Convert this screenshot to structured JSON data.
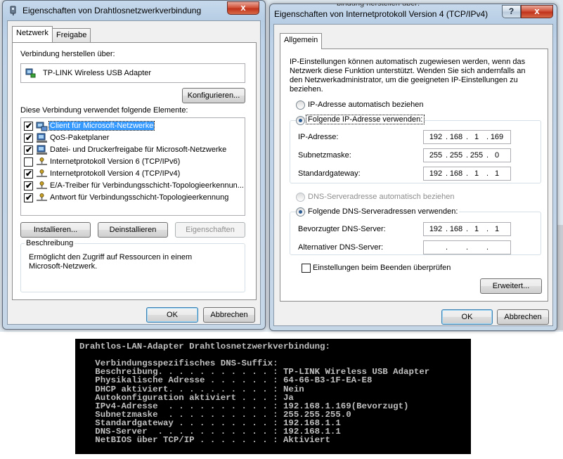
{
  "window1": {
    "title": "Eigenschaften von Drahtlosnetzwerkverbindung",
    "close_label": "x",
    "tabs": [
      {
        "label": "Netzwerk"
      },
      {
        "label": "Freigabe"
      }
    ],
    "connect_via_label": "Verbindung herstellen über:",
    "adapter_name": "TP-LINK Wireless USB Adapter",
    "configure_label": "Konfigurieren...",
    "elements_label": "Diese Verbindung verwendet folgende Elemente:",
    "items": [
      {
        "label": "Client für Microsoft-Netzwerke",
        "checked": true,
        "selected": true,
        "icon": "network-client-icon"
      },
      {
        "label": "QoS-Paketplaner",
        "checked": true,
        "selected": false,
        "icon": "network-service-icon"
      },
      {
        "label": "Datei- und Druckerfreigabe für Microsoft-Netzwerke",
        "checked": true,
        "selected": false,
        "icon": "network-service-icon"
      },
      {
        "label": "Internetprotokoll Version 6 (TCP/IPv6)",
        "checked": false,
        "selected": false,
        "icon": "protocol-icon"
      },
      {
        "label": "Internetprotokoll Version 4 (TCP/IPv4)",
        "checked": true,
        "selected": false,
        "icon": "protocol-icon"
      },
      {
        "label": "E/A-Treiber für Verbindungsschicht-Topologieerkennun...",
        "checked": true,
        "selected": false,
        "icon": "protocol-icon"
      },
      {
        "label": "Antwort für Verbindungsschicht-Topologieerkennung",
        "checked": true,
        "selected": false,
        "icon": "protocol-icon"
      }
    ],
    "install_label": "Installieren...",
    "uninstall_label": "Deinstallieren",
    "properties_label": "Eigenschaften",
    "description_title": "Beschreibung",
    "description_line1": "Ermöglicht den Zugriff auf Ressourcen in einem",
    "description_line2": "Microsoft-Netzwerk.",
    "ok_label": "OK",
    "cancel_label": "Abbrechen"
  },
  "window2": {
    "title": "Eigenschaften von Internetprotokoll Version 4 (TCP/IPv4)",
    "help_label": "?",
    "close_label": "x",
    "tab_label": "Allgemein",
    "info_line1": "IP-Einstellungen können automatisch zugewiesen werden, wenn das",
    "info_line2": "Netzwerk diese Funktion unterstützt. Wenden Sie sich andernfalls an",
    "info_line3": "den Netzwerkadministrator, um die geeigneten IP-Einstellungen zu",
    "info_line4": "beziehen.",
    "radio_ip_auto": "IP-Adresse automatisch beziehen",
    "radio_ip_manual": "Folgende IP-Adresse verwenden:",
    "ip_label": "IP-Adresse:",
    "ip": [
      "192",
      "168",
      "1",
      "169"
    ],
    "subnet_label": "Subnetzmaske:",
    "subnet": [
      "255",
      "255",
      "255",
      "0"
    ],
    "gateway_label": "Standardgateway:",
    "gateway": [
      "192",
      "168",
      "1",
      "1"
    ],
    "radio_dns_auto": "DNS-Serveradresse automatisch beziehen",
    "radio_dns_manual": "Folgende DNS-Serveradressen verwenden:",
    "dns_pref_label": "Bevorzugter DNS-Server:",
    "dns_pref": [
      "192",
      "168",
      "1",
      "1"
    ],
    "dns_alt_label": "Alternativer DNS-Server:",
    "dns_alt": [
      "",
      "",
      "",
      ""
    ],
    "validate_label": "Einstellungen beim Beenden überprüfen",
    "advanced_label": "Erweitert...",
    "ok_label": "OK",
    "cancel_label": "Abbrechen",
    "covered_title_fragment": "bindung herstellen über:"
  },
  "console": {
    "lines": [
      "Drahtlos-LAN-Adapter Drahtlosnetzwerkverbindung:",
      "",
      "   Verbindungsspezifisches DNS-Suffix:",
      "   Beschreibung. . . . . . . . . . . : TP-LINK Wireless USB Adapter",
      "   Physikalische Adresse . . . . . . : 64-66-B3-1F-EA-E8",
      "   DHCP aktiviert. . . . . . . . . . : Nein",
      "   Autokonfiguration aktiviert . . . : Ja",
      "   IPv4-Adresse  . . . . . . . . . . : 192.168.1.169(Bevorzugt)",
      "   Subnetzmaske  . . . . . . . . . . : 255.255.255.0",
      "   Standardgateway . . . . . . . . . : 192.168.1.1",
      "   DNS-Server  . . . . . . . . . . . : 192.168.1.1",
      "   NetBIOS über TCP/IP . . . . . . . : Aktiviert"
    ]
  },
  "colors": {
    "selection": "#3399ff",
    "console_bg": "#000000",
    "console_fg": "#c0c0c0",
    "close_red": "#c0331b"
  }
}
